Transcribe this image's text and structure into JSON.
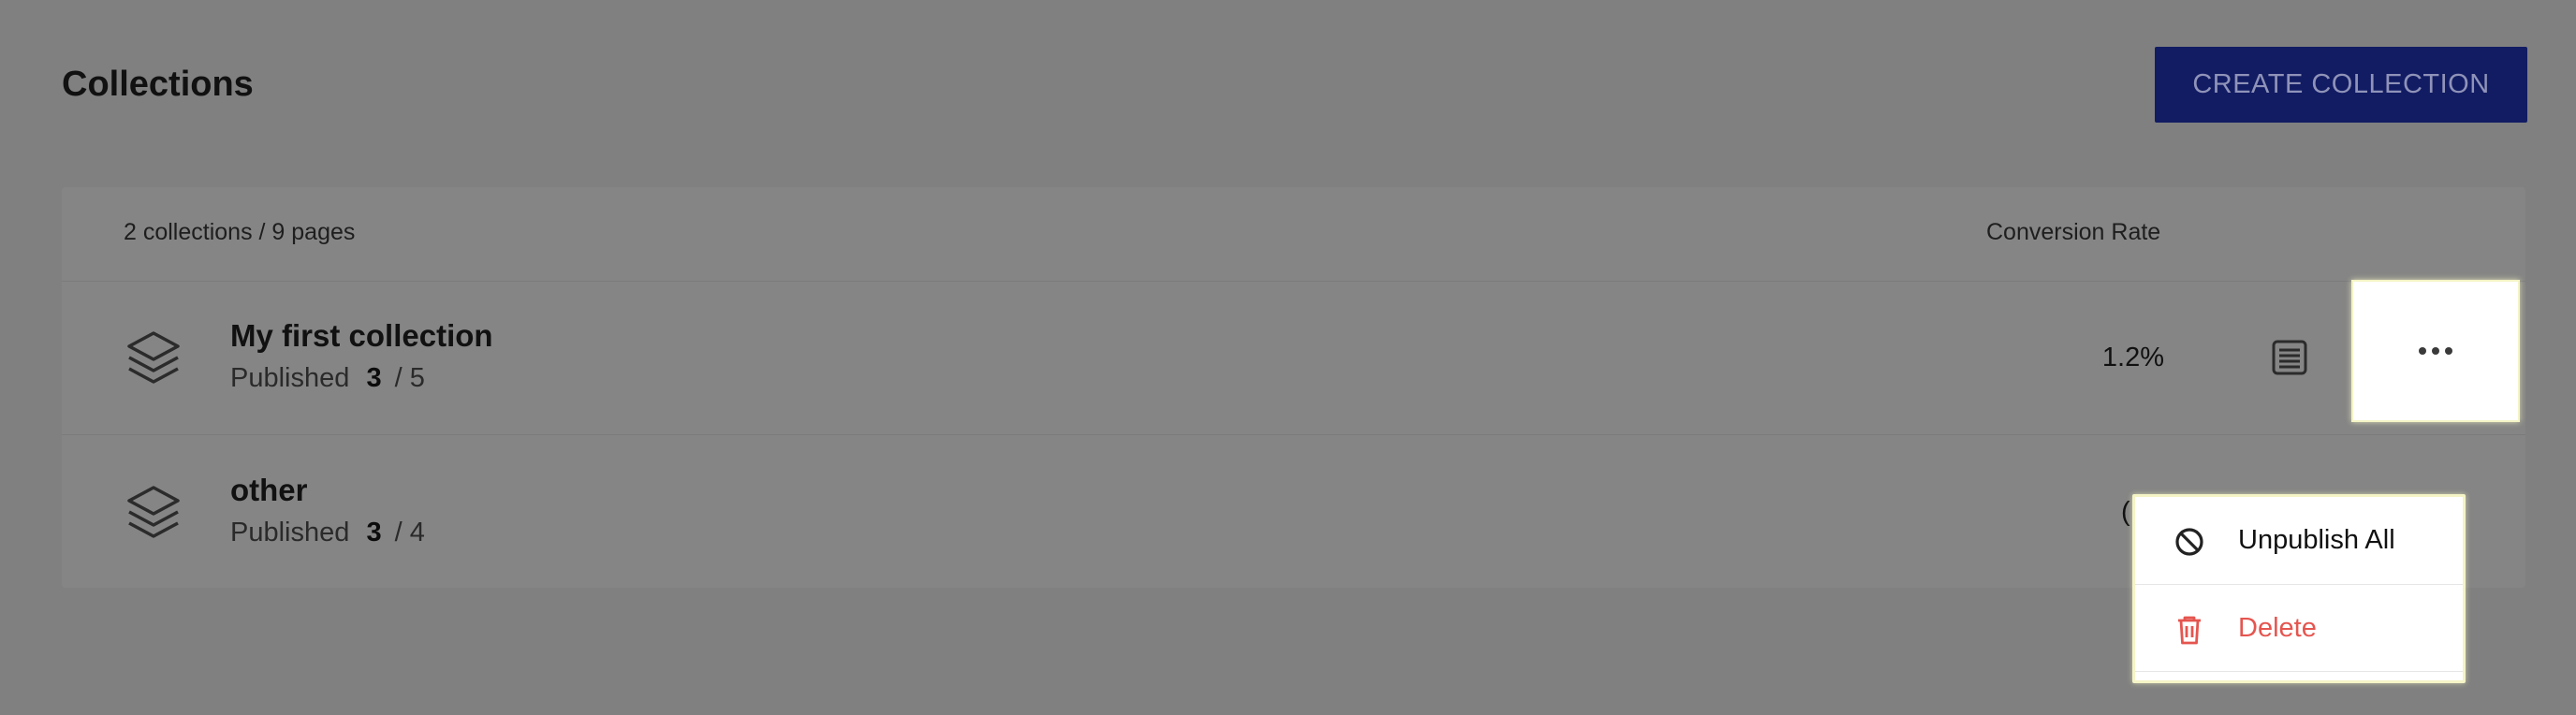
{
  "header": {
    "title": "Collections",
    "create_button_label": "CREATE COLLECTION"
  },
  "table": {
    "summary": "2 collections / 9 pages",
    "conversion_rate_header": "Conversion Rate",
    "rows": [
      {
        "name": "My first collection",
        "status_label": "Published",
        "published_count": "3",
        "total_count": "/ 5",
        "conversion_rate": "1.2%"
      },
      {
        "name": "other",
        "status_label": "Published",
        "published_count": "3",
        "total_count": "/ 4",
        "conversion_rate": "("
      }
    ]
  },
  "dropdown_menu": {
    "items": [
      {
        "label": "Unpublish All",
        "icon": "block-icon"
      },
      {
        "label": "Delete",
        "icon": "trash-icon"
      }
    ]
  },
  "colors": {
    "overlay_background": "#808080",
    "primary_button": "#121c63",
    "delete_red": "#e5554f"
  }
}
